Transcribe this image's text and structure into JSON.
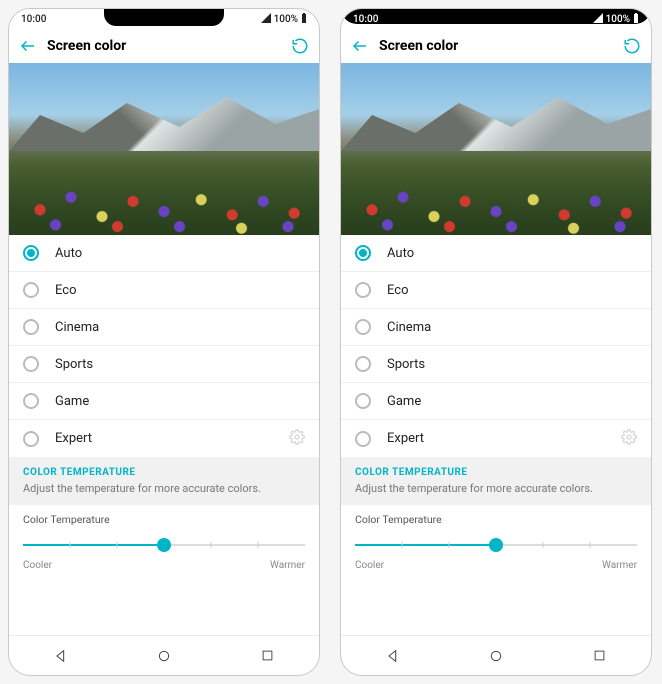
{
  "phones": [
    {
      "statusbar": {
        "time": "10:00",
        "battery_pct": "100%",
        "notch": "small"
      }
    },
    {
      "statusbar": {
        "time": "10:00",
        "battery_pct": "100%",
        "notch": "wide"
      }
    }
  ],
  "header": {
    "title": "Screen color"
  },
  "color_modes": [
    {
      "label": "Auto",
      "selected": true
    },
    {
      "label": "Eco",
      "selected": false
    },
    {
      "label": "Cinema",
      "selected": false
    },
    {
      "label": "Sports",
      "selected": false
    },
    {
      "label": "Game",
      "selected": false
    },
    {
      "label": "Expert",
      "selected": false,
      "has_gear": true
    }
  ],
  "color_temperature": {
    "heading": "COLOR TEMPERATURE",
    "description": "Adjust the temperature for more accurate colors.",
    "slider_title": "Color Temperature",
    "slider_fraction": 0.5,
    "min_label": "Cooler",
    "max_label": "Warmer"
  }
}
